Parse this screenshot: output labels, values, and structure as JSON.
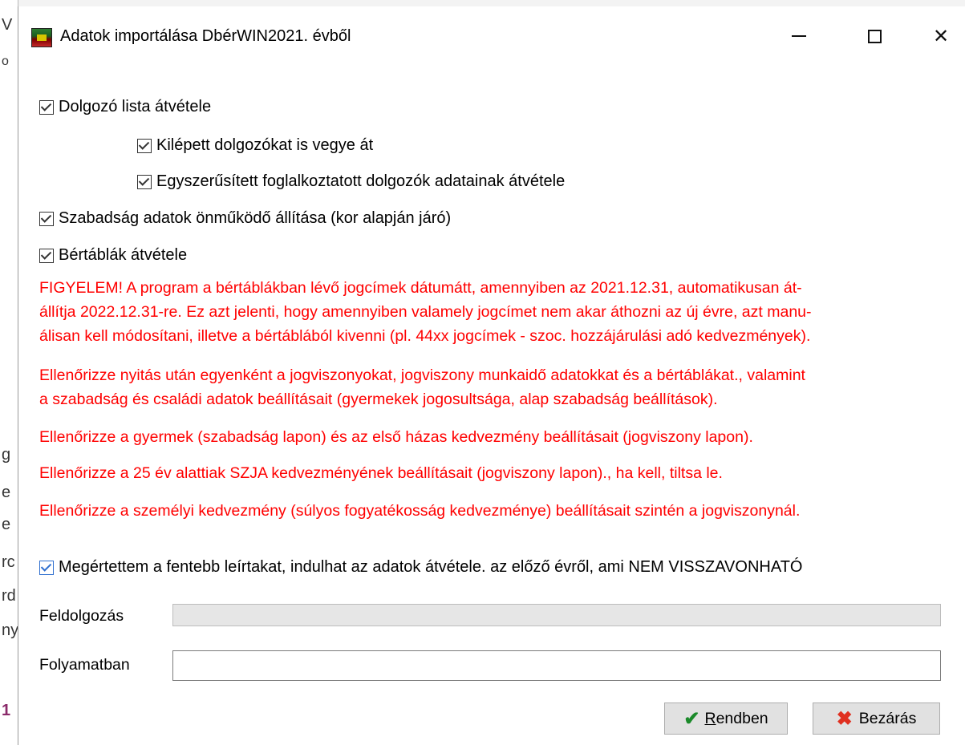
{
  "background_window": {
    "chars": [
      "V",
      "o",
      "g",
      "e",
      "e",
      "rc",
      "rd",
      "ny",
      "1"
    ]
  },
  "titlebar": {
    "title": "Adatok importálása DbérWIN2021. évből",
    "icon": "app-icon",
    "minimize_icon": "minimize-icon",
    "maximize_icon": "maximize-icon",
    "close_glyph": "✕"
  },
  "options": {
    "employee_list": {
      "label": "Dolgozó lista átvétele",
      "checked": true
    },
    "terminated": {
      "label": "Kilépett dolgozókat is vegye át",
      "checked": true
    },
    "simplified": {
      "label": "Egyszerűsített foglalkoztatott dolgozók adatainak átvétele",
      "checked": true
    },
    "vacation": {
      "label": "Szabadság adatok önműködő állítása (kor alapján járó)",
      "checked": true
    },
    "pay_tables": {
      "label": "Bértáblák átvétele",
      "checked": true
    }
  },
  "warnings": {
    "w1_line1": "FIGYELEM! A program a bértáblákban lévő jogcímek dátumátt, amennyiben az 2021.12.31, automatikusan át-",
    "w1_line2": "állítja 2022.12.31-re. Ez azt jelenti, hogy amennyiben valamely jogcímet nem akar áthozni az új évre, azt manu-",
    "w1_line3": "álisan kell módosítani, illetve a bértáblából kivenni (pl. 44xx jogcímek  - szoc. hozzájárulási adó kedvezmények).",
    "w2_line1": "Ellenőrizze nyitás után egyenként a jogviszonyokat, jogviszony munkaidő adatokkat és a bértáblákat., valamint",
    "w2_line2": "a szabadság és családi adatok beállításait (gyermekek jogosultsága, alap szabadság beállítások).",
    "w3": "Ellenőrizze a gyermek (szabadság lapon) és az első házas kedvezmény beállításait (jogviszony lapon).",
    "w4": "Ellenőrizze a 25 év alattiak SZJA kedvezményének beállításait (jogviszony lapon)., ha kell, tiltsa le.",
    "w5": "Ellenőrizze a személyi kedvezmény (súlyos fogyatékosság kedvezménye) beállításait szintén a jogviszonynál.",
    "color": "#ff0000"
  },
  "confirm": {
    "label": "Megértettem a fentebb leírtakat, indulhat az adatok átvétele. az előző évről, ami NEM VISSZAVONHATÓ",
    "checked": true
  },
  "processing": {
    "label": "Feldolgozás",
    "progress": 0
  },
  "in_progress": {
    "label": "Folyamatban",
    "value": ""
  },
  "buttons": {
    "ok_prefix": "",
    "ok_underlined": "R",
    "ok_rest": "endben",
    "cancel": "Bezárás"
  }
}
